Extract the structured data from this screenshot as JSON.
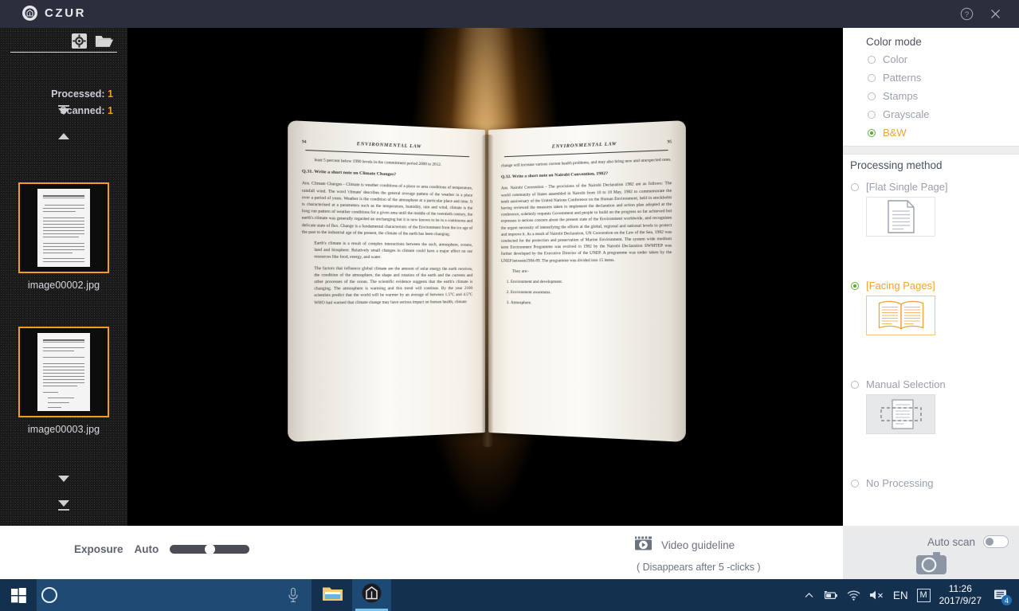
{
  "titlebar": {
    "app_name": "CZUR",
    "help_icon": "help-circle-icon",
    "close_icon": "close-icon"
  },
  "sidebar": {
    "settings_icon": "gear-icon",
    "open_folder_icon": "folder-open-icon",
    "processed_label": "Processed:",
    "processed_count": "1",
    "scanned_label": "Scanned:",
    "scanned_count": "1",
    "nav": {
      "first_icon": "jump-to-first-icon",
      "prev_icon": "scroll-up-icon",
      "next_icon": "scroll-down-icon",
      "last_icon": "jump-to-last-icon"
    },
    "thumbnails": [
      {
        "label": "image00002.jpg",
        "selected": true
      },
      {
        "label": "image00003.jpg",
        "selected": true
      }
    ]
  },
  "preview": {
    "left_page": {
      "page_number": "94",
      "running_head": "ENVIRONMENTAL LAW",
      "paragraphs": [
        "least 5 percent below 1990 levels in the commitment period 2008 to 2012.",
        "Q.31. Write a short note on Climate Changes?",
        "Ans. Climate Changes - Climate is weather conditions of a place or area conditions of temperature, rainfall wind. The word 'climate' describes the general average pattern of the weather in a place over a period of years. Weather is the condition of the atmosphere at a particular place and time. It is characterised at a parameters such as the temperature, humidity, rain and wind, climate is the long run pattern of weather conditions for a given area until the middle of the twentieth century, the earth's climate was generally regarded an unchanging but it is now known to be in a continuous and delicate state of flux. Change is a fundamental characteristic of the Environment from the ice age of the past to the industrial age of the present, the climate of the earth has been changing.",
        "Earth's climate is a result of complex interactions between the such, atmosphere, oceans, land and biosphere. Relatively small changes in climate could have a major effect on our resources like food, energy, and water.",
        "The factors that influence global climate are the amount of solar energy the earth receives, the condition of the atmosphere, the shape and rotation of the earth and the currents and other processes of the ocean. The scientific evidence suggests that the earth's climate is changing. The atmosphere is warming and this trend will continue. By the year 2100 scientists predict that the world will be warmer by an average of between 1.5°C and 4.5°C WHO had warned that climate change may have serious impact on human health, climate"
      ]
    },
    "right_page": {
      "page_number": "95",
      "running_head": "ENVIRONMENTAL LAW",
      "paragraphs": [
        "change will increase various current health problems, and may also bring new and unexpected ones.",
        "Q.32. Write a short note on Nairobi Convention, 1982?",
        "Ans. Nairobi Convention - The provisions of the Nairobi Declaration 1982 are as follows: The world community of States assembled in Nairobi from 10 to 18 May, 1982 to commemorate the tenth anniversary of the United Nations Conference on the Human Environment, held in stockholm having reviewed the measures taken to implement the declaration and action plan adopted at the conference, solemnly requests Government and people to build on the progress so far achieved but expresses is serious concern about the present state of the Environment worldwide, and recognizes the urgent necessity of intensifying the efforts at the global, regional and national levels to protect and improve it. As a result of Nairobi Declaration, UN Convention on the Law of the Sea, 1982 was conducted for the protection and preservation of Marine Environment. The system wide medium term Environment Programme was evolved in 1982 by the Nairobi Declaration SWMTEP was further developed by the Executive Director of the UNEP. A programme was under taken by the UNEP between1984-89.  The programme was divided into 15 items.",
        "They are:-"
      ],
      "list": [
        "Environment and development.",
        "Environment awareness.",
        "Atmosphere."
      ]
    }
  },
  "right_panel": {
    "color_mode": {
      "heading": "Color mode",
      "options": [
        {
          "label": "Color",
          "selected": false
        },
        {
          "label": "Patterns",
          "selected": false
        },
        {
          "label": "Stamps",
          "selected": false
        },
        {
          "label": "Grayscale",
          "selected": false
        },
        {
          "label": "B&W",
          "selected": true
        }
      ]
    },
    "processing_method": {
      "heading": "Processing method",
      "options": [
        {
          "label": "[Flat Single Page]",
          "selected": false,
          "icon": "single-page-icon"
        },
        {
          "label": "[Facing Pages]",
          "selected": true,
          "icon": "facing-pages-icon"
        },
        {
          "label": "Manual Selection",
          "selected": false,
          "icon": "manual-selection-icon"
        },
        {
          "label": "No Processing",
          "selected": false,
          "icon": ""
        }
      ]
    },
    "footer": {
      "auto_scan_label": "Auto scan",
      "auto_scan_on": false,
      "capture_icon": "camera-icon"
    }
  },
  "bottom_bar": {
    "exposure_label": "Exposure",
    "auto_label": "Auto",
    "slider_value": 46,
    "video_guideline_label": "Video guideline",
    "video_guideline_icon": "video-play-icon",
    "video_guideline_sub": "( Disappears after 5 -clicks )"
  },
  "taskbar": {
    "start_icon": "windows-start-icon",
    "cortana_icon": "cortana-circle-icon",
    "mic_icon": "microphone-icon",
    "apps": [
      {
        "name": "file-explorer",
        "icon": "folder-icon",
        "active": false
      },
      {
        "name": "czur",
        "icon": "czur-icon",
        "active": true
      }
    ],
    "tray": {
      "chevron_icon": "chevron-up-icon",
      "battery_icon": "battery-icon",
      "wifi_icon": "wifi-icon",
      "volume_icon": "volume-mute-icon",
      "language": "EN",
      "ime": "M",
      "time": "11:26",
      "date": "2017/9/27",
      "notification_icon": "notification-icon",
      "notification_count": "4"
    }
  },
  "colors": {
    "accent_orange": "#f0a020",
    "titlebar_bg": "#2b2f3d",
    "taskbar_bg": "#14304f",
    "radio_green": "#55ab2d"
  }
}
